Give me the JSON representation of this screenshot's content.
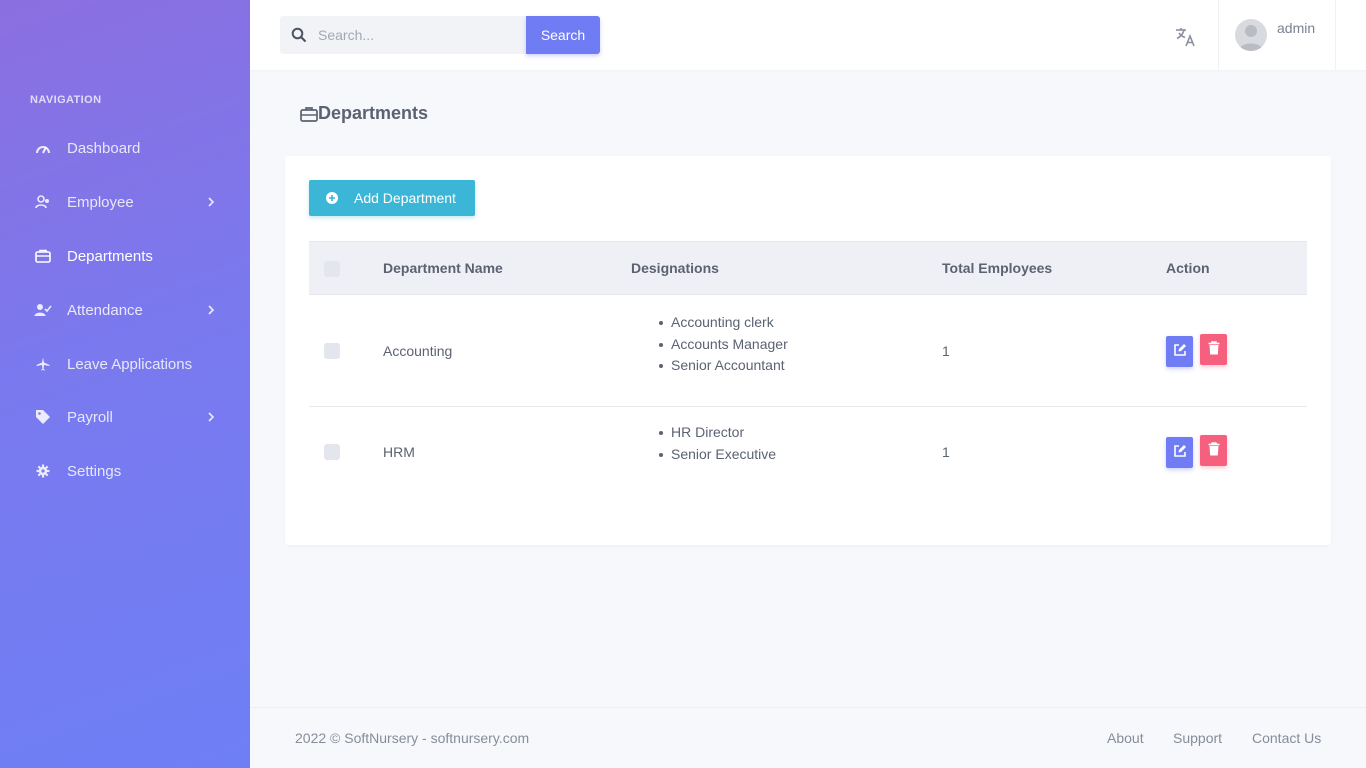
{
  "sidebar": {
    "heading": "NAVIGATION",
    "items": [
      {
        "label": "Dashboard",
        "icon": "speedometer-icon"
      },
      {
        "label": "Employee",
        "icon": "users-icon"
      },
      {
        "label": "Departments",
        "icon": "briefcase-icon"
      },
      {
        "label": "Attendance",
        "icon": "user-check-icon"
      },
      {
        "label": "Leave Applications",
        "icon": "airplane-icon"
      },
      {
        "label": "Payroll",
        "icon": "tag-icon"
      },
      {
        "label": "Settings",
        "icon": "gear-icon"
      }
    ],
    "active_item": "Departments"
  },
  "topbar": {
    "search_placeholder": "Search...",
    "search_button": "Search",
    "username": "admin"
  },
  "page": {
    "title": "Departments"
  },
  "card": {
    "add_button": "Add Department",
    "columns": [
      "Department Name",
      "Designations",
      "Total Employees",
      "Action"
    ],
    "rows": [
      {
        "name": "Accounting",
        "designations": [
          "Accounting clerk",
          "Accounts Manager",
          "Senior Accountant"
        ],
        "total": "1"
      },
      {
        "name": "HRM",
        "designations": [
          "HR Director",
          "Senior Executive"
        ],
        "total": "1"
      }
    ]
  },
  "footer": {
    "copyright": "2022 © SoftNursery - softnursery.com",
    "links": [
      "About",
      "Support",
      "Contact Us"
    ]
  },
  "colors": {
    "sidebar_gradient_start": "#8b6fe0",
    "sidebar_gradient_end": "#6e7ff6",
    "primary": "#6f7cf3",
    "info": "#3bb6d6",
    "danger": "#f4607d"
  }
}
